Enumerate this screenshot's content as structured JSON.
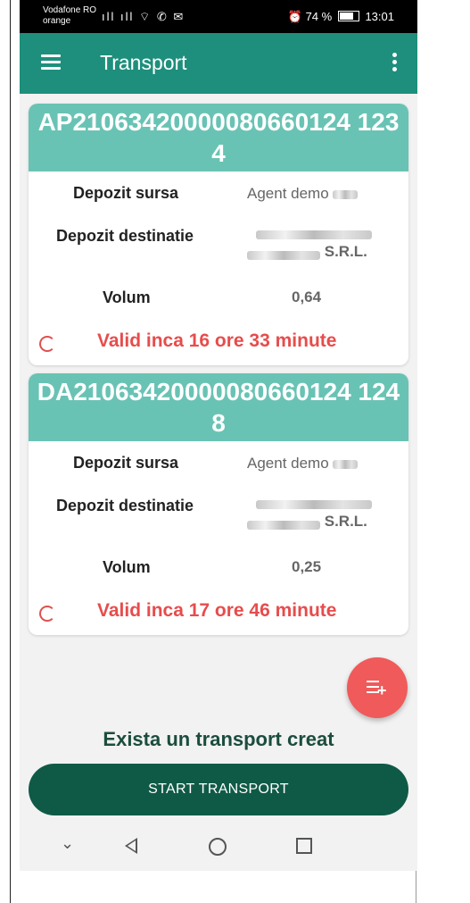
{
  "status_bar": {
    "carrier_line1": "Vodafone RO",
    "carrier_line2": "orange",
    "signal_icons": "ıll ıll ⌔ ✆ ✉",
    "alarm_icon": "⏰",
    "battery_percent": "74 %",
    "time": "13:01"
  },
  "app_bar": {
    "title": "Transport",
    "menu_icon": "hamburger-menu",
    "more_icon": "vertical-dots"
  },
  "labels": {
    "source": "Depozit sursa",
    "destination": "Depozit destinatie",
    "volume": "Volum"
  },
  "transports": [
    {
      "code": "AP21063420000080660124 1234",
      "source_value": "Agent demo",
      "destination_suffix": "S.R.L.",
      "volume": "0,64",
      "validity": "Valid inca 16 ore 33 minute"
    },
    {
      "code": "DA21063420000080660124 1248",
      "source_value": "Agent demo",
      "destination_suffix": "S.R.L.",
      "volume": "0,25",
      "validity": "Valid inca 17 ore 46 minute"
    }
  ],
  "info_text": "Exista un transport creat",
  "start_button": "START TRANSPORT",
  "colors": {
    "app_bar": "#1e8f7c",
    "card_header": "#69c3b4",
    "validity_text": "#e74c4c",
    "fab": "#f05a5a",
    "start_button": "#0f5a46"
  }
}
